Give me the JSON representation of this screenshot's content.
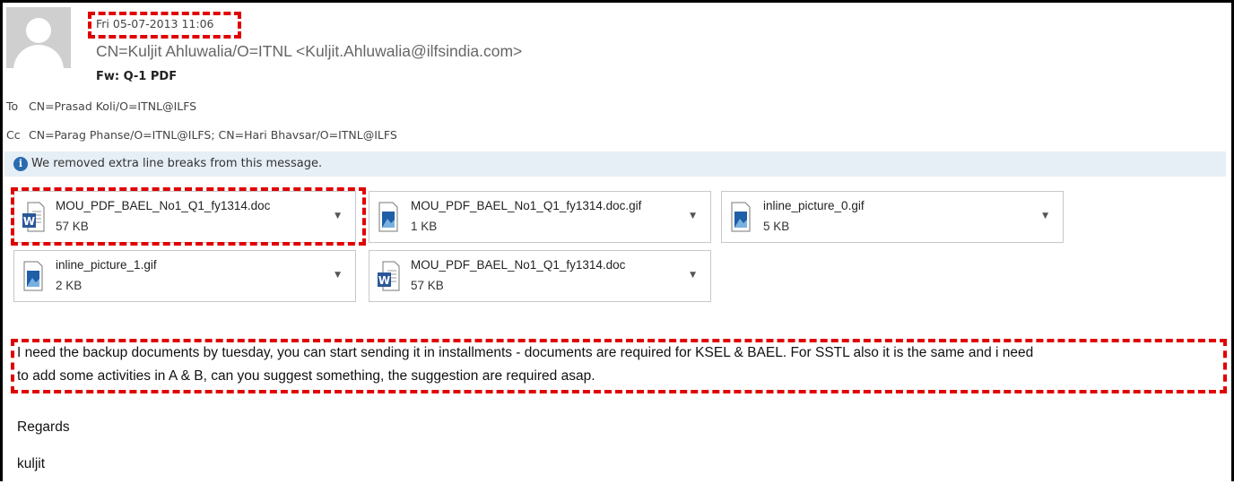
{
  "message": {
    "date": "Fri 05-07-2013 11:06",
    "sender": "CN=Kuljit Ahluwalia/O=ITNL <Kuljit.Ahluwalia@ilfsindia.com>",
    "subject": "Fw: Q-1 PDF",
    "to_label": "To",
    "to_value": "CN=Prasad Koli/O=ITNL@ILFS",
    "cc_label": "Cc",
    "cc_value": "CN=Parag Phanse/O=ITNL@ILFS; CN=Hari Bhavsar/O=ITNL@ILFS",
    "info_bar": "We removed extra line breaks from this message."
  },
  "attachments": [
    {
      "name": "MOU_PDF_BAEL_No1_Q1_fy1314.doc",
      "size": "57 KB",
      "icon": "word-document-icon"
    },
    {
      "name": "MOU_PDF_BAEL_No1_Q1_fy1314.doc.gif",
      "size": "1 KB",
      "icon": "image-file-icon"
    },
    {
      "name": "inline_picture_0.gif",
      "size": "5 KB",
      "icon": "image-file-icon"
    },
    {
      "name": "inline_picture_1.gif",
      "size": "2 KB",
      "icon": "image-file-icon"
    },
    {
      "name": "MOU_PDF_BAEL_No1_Q1_fy1314.doc",
      "size": "57 KB",
      "icon": "word-document-icon"
    }
  ],
  "body": {
    "line1": "I need the backup documents by tuesday, you can start sending it in installments - documents are required for KSEL & BAEL. For SSTL also it is the same and i need",
    "line2": "to add some activities in A & B, can you suggest something, the suggestion are required asap.",
    "regards": "Regards",
    "signature": "kuljit"
  },
  "colors": {
    "highlight": "#e00000",
    "info_bar_bg": "#e6eef6",
    "info_icon": "#2b6cb0",
    "word_blue": "#2b579a",
    "image_blue": "#1f5fa8"
  }
}
